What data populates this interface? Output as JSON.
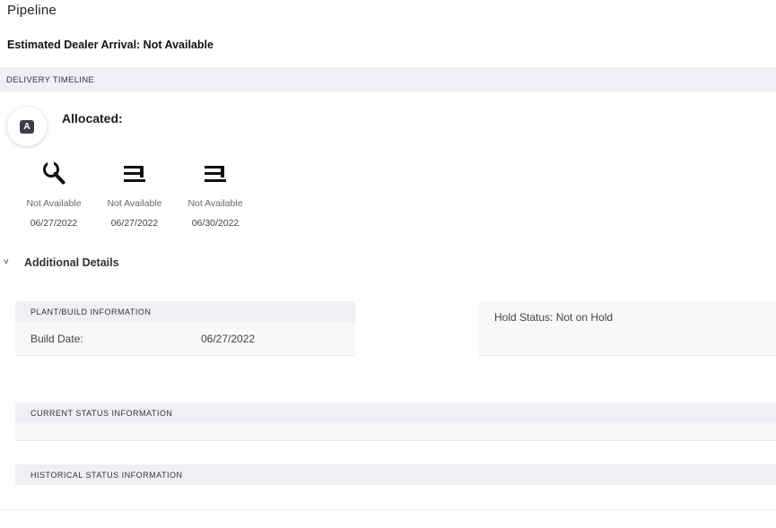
{
  "page": {
    "title": "Pipeline",
    "eta": "Estimated Dealer Arrival: Not Available"
  },
  "timeline": {
    "header": "DELIVERY TIMELINE",
    "badge_letter": "A",
    "status_label": "Allocated:",
    "steps": [
      {
        "icon": "wrench-icon",
        "status": "Not Available",
        "date": "06/27/2022"
      },
      {
        "icon": "train-icon",
        "status": "Not Available",
        "date": "06/27/2022"
      },
      {
        "icon": "train-icon",
        "status": "Not Available",
        "date": "06/30/2022"
      }
    ]
  },
  "details": {
    "toggle_label": "Additional Details",
    "chevron": "˅",
    "plant": {
      "header": "PLANT/BUILD INFORMATION",
      "build_date_label": "Build Date:",
      "build_date_value": "06/27/2022"
    },
    "hold_status": "Hold Status: Not on Hold",
    "current_status": {
      "header": "CURRENT STATUS INFORMATION"
    },
    "historical_status": {
      "header": "HISTORICAL STATUS INFORMATION"
    }
  }
}
